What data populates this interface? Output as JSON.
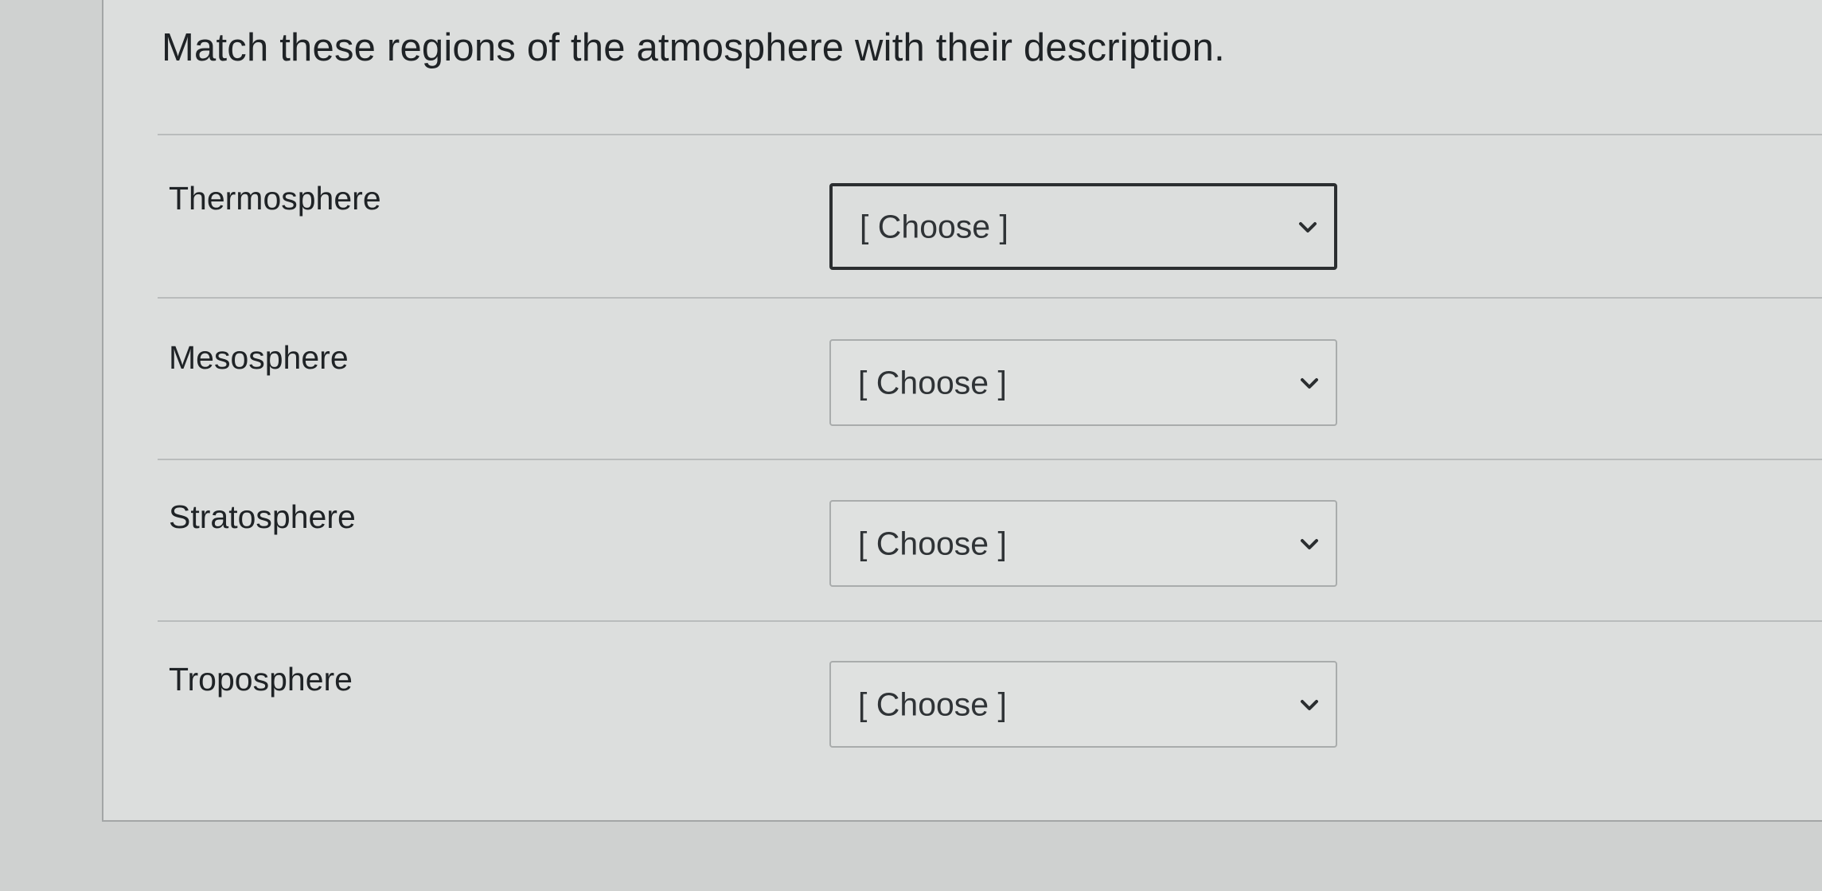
{
  "question": {
    "prompt": "Match these regions of the atmosphere with their description."
  },
  "rows": [
    {
      "label": "Thermosphere",
      "select_value": "[ Choose ]",
      "focused": true
    },
    {
      "label": "Mesosphere",
      "select_value": "[ Choose ]",
      "focused": false
    },
    {
      "label": "Stratosphere",
      "select_value": "[ Choose ]",
      "focused": false
    },
    {
      "label": "Troposphere",
      "select_value": "[ Choose ]",
      "focused": false
    }
  ],
  "icons": {
    "dropdown": "chevron-down-icon"
  }
}
